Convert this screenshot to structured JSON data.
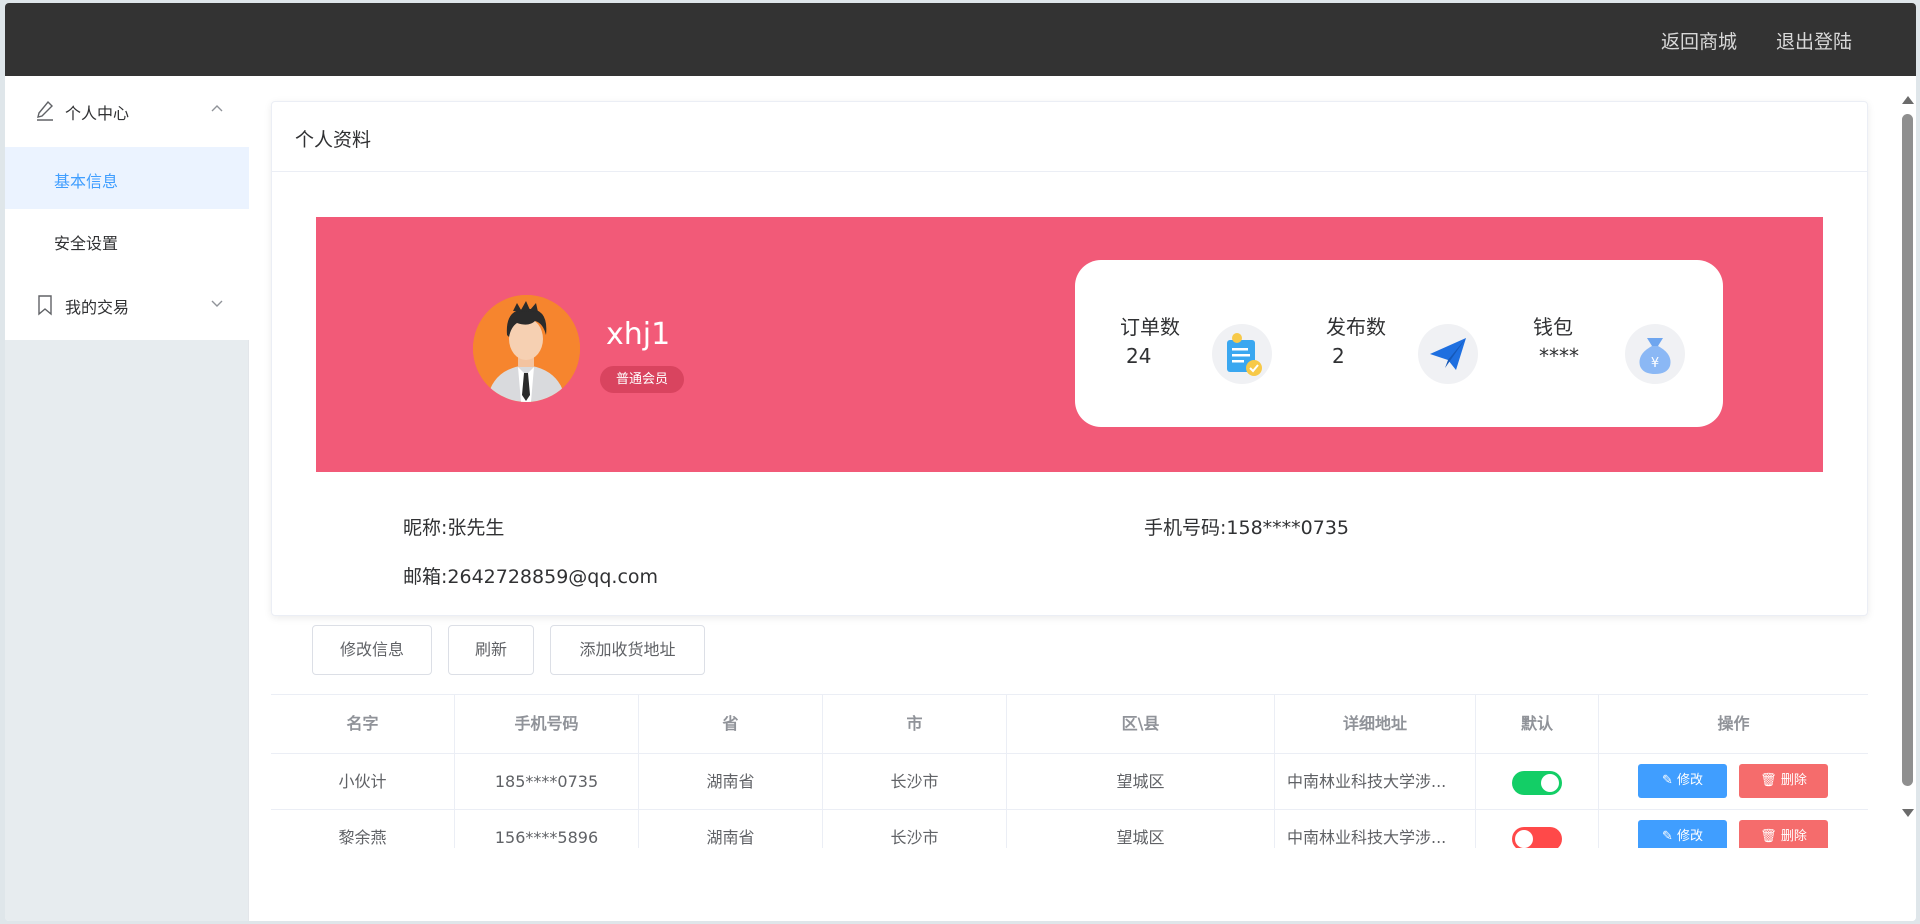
{
  "topbar": {
    "back_to_shop": "返回商城",
    "logout": "退出登陆"
  },
  "sidebar": {
    "groups": [
      {
        "label": "个人中心",
        "icon": "edit-icon",
        "expanded": true,
        "items": [
          {
            "label": "基本信息",
            "active": true
          },
          {
            "label": "安全设置",
            "active": false
          }
        ]
      },
      {
        "label": "我的交易",
        "icon": "bookmark-icon",
        "expanded": false
      }
    ]
  },
  "profile": {
    "card_title": "个人资料",
    "username": "xhj1",
    "member_level": "普通会员",
    "stats": [
      {
        "label": "订单数",
        "value": "24",
        "icon": "order-clipboard-icon"
      },
      {
        "label": "发布数",
        "value": "2",
        "icon": "paper-plane-icon"
      },
      {
        "label": "钱包",
        "value": "****",
        "icon": "money-bag-icon"
      }
    ],
    "nickname_label": "昵称:",
    "nickname": "张先生",
    "phone_label": "手机号码:",
    "phone": "158****0735",
    "email_label": "邮箱:",
    "email": "2642728859@qq.com",
    "banner_color": "#f25a78"
  },
  "actions": {
    "edit_info": "修改信息",
    "refresh": "刷新",
    "add_address": "添加收货地址"
  },
  "address_table": {
    "columns": [
      "名字",
      "手机号码",
      "省",
      "市",
      "区\\县",
      "详细地址",
      "默认",
      "操作"
    ],
    "rows": [
      {
        "name": "小伙计",
        "phone": "185****0735",
        "province": "湖南省",
        "city": "长沙市",
        "district": "望城区",
        "detail": "中南林业科技大学涉...",
        "default": true
      },
      {
        "name": "黎余燕",
        "phone": "156****5896",
        "province": "湖南省",
        "city": "长沙市",
        "district": "望城区",
        "detail": "中南林业科技大学涉...",
        "default": false
      }
    ],
    "edit_label": "修改",
    "delete_label": "删除"
  },
  "colors": {
    "topbar": "#333333",
    "accent": "#409eff",
    "danger": "#f56c6c",
    "toggle_on": "#13ce66",
    "toggle_off": "#ff4949"
  }
}
